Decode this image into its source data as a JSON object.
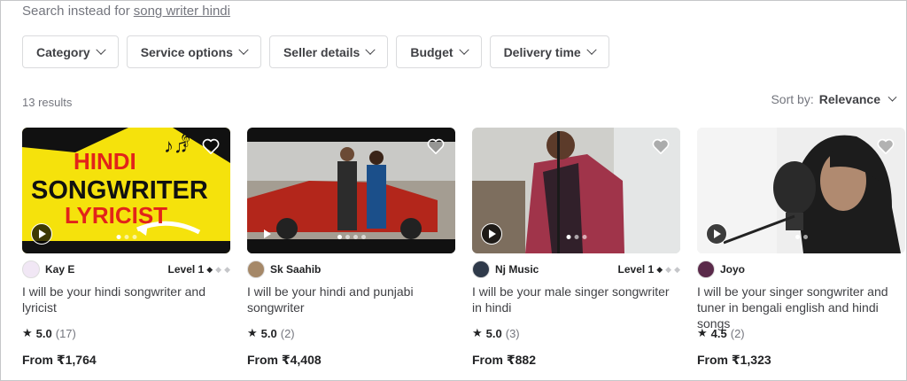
{
  "search_instead": {
    "prefix": "Search instead for",
    "query": "song writer hindi"
  },
  "filters": [
    "Category",
    "Service options",
    "Seller details",
    "Budget",
    "Delivery time"
  ],
  "results": {
    "count_label": "13 results"
  },
  "sort": {
    "label": "Sort by:",
    "value": "Relevance"
  },
  "cards": [
    {
      "seller": "Kay E",
      "level": "Level 1",
      "title": "I will be your hindi songwriter and lyricist",
      "rating": "5.0",
      "reviews": "(17)",
      "price": "From ₹1,764",
      "thumb_text": [
        "HINDI",
        "SONGWRITER",
        "LYRICIST"
      ]
    },
    {
      "seller": "Sk Saahib",
      "level": "",
      "title": "I will be your hindi and punjabi songwriter",
      "rating": "5.0",
      "reviews": "(2)",
      "price": "From ₹4,408"
    },
    {
      "seller": "Nj Music",
      "level": "Level 1",
      "title": "I will be your male singer songwriter in hindi",
      "rating": "5.0",
      "reviews": "(3)",
      "price": "From ₹882"
    },
    {
      "seller": "Joyo",
      "level": "",
      "title": "I will be your singer songwriter and tuner in bengali english and hindi songs",
      "rating": "4.5",
      "reviews": "(2)",
      "price": "From ₹1,323"
    }
  ],
  "icons": {
    "heart": "heart-icon",
    "play": "play-icon",
    "star": "star-icon",
    "chevron": "chevron-down-icon"
  },
  "colors": {
    "text": "#404145",
    "muted": "#74767e",
    "border": "#dadbdd"
  }
}
